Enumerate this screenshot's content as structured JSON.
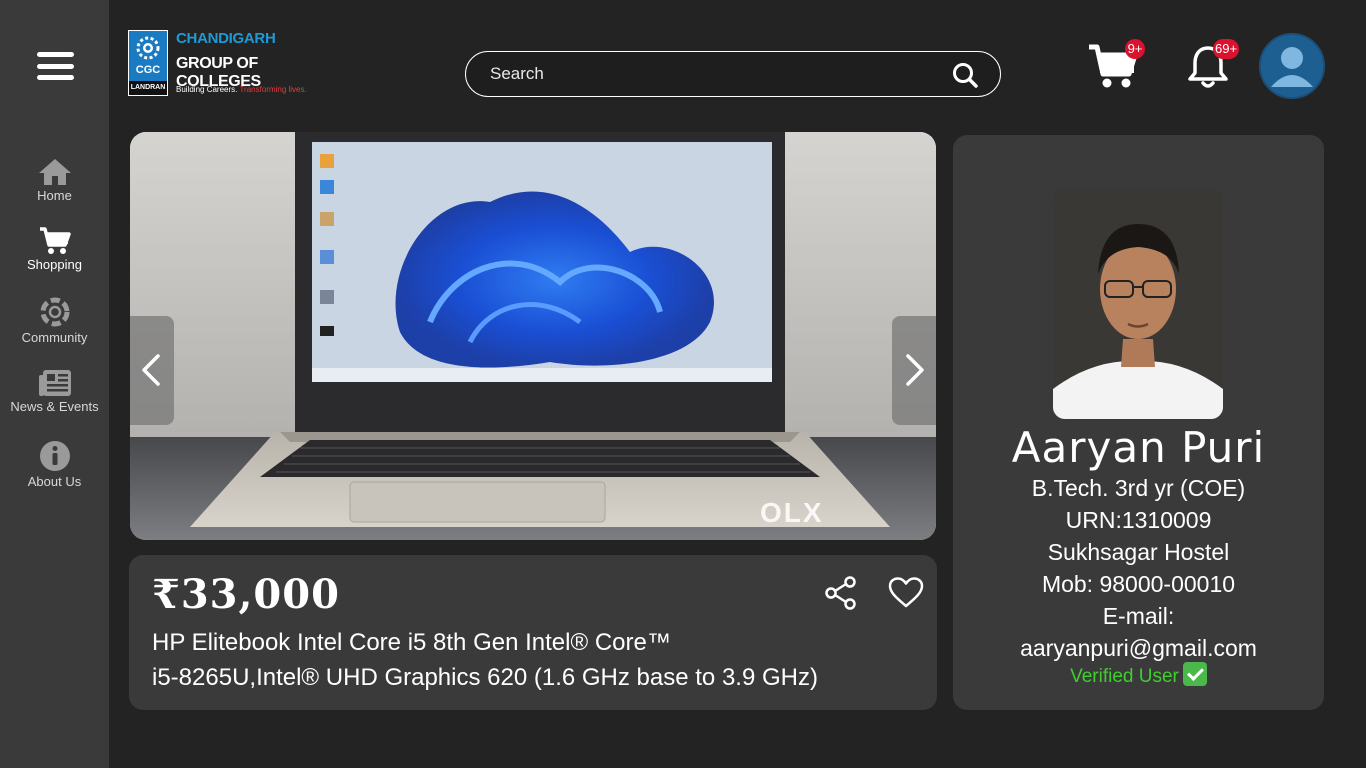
{
  "sidebar": {
    "items": [
      {
        "label": "Home",
        "icon": "home-icon"
      },
      {
        "label": "Shopping",
        "icon": "cart-icon"
      },
      {
        "label": "Community",
        "icon": "community-icon"
      },
      {
        "label": "News & Events",
        "icon": "news-icon"
      },
      {
        "label": "About Us",
        "icon": "info-icon"
      }
    ],
    "active": "Shopping"
  },
  "header": {
    "logo": {
      "badge_text": "CGC",
      "badge_sub": "LANDRAN",
      "line1": "CHANDIGARH",
      "line2": "GROUP OF COLLEGES",
      "tagline_a": "Building Careers.",
      "tagline_b": "Transforming lives."
    },
    "search": {
      "placeholder": "Search"
    },
    "cart_badge": "9+",
    "notifications_badge": "69+"
  },
  "product": {
    "price": "₹33,000",
    "title_line1": "HP Elitebook Intel Core i5 8th Gen Intel® Core™",
    "title_line2": "i5-8265U,Intel® UHD Graphics 620 (1.6 GHz base to 3.9 GHz)",
    "image_watermark": "OLX"
  },
  "seller": {
    "name": "Aaryan Puri",
    "course": "B.Tech. 3rd yr (COE)",
    "urn": "URN:1310009",
    "hostel": "Sukhsagar Hostel",
    "mobile": "Mob: 98000-00010",
    "email_label": "E-mail:",
    "email": "aaryanpuri@gmail.com",
    "verified": "Verified User"
  },
  "colors": {
    "background": "#232323",
    "sidebar": "#3a3a3a",
    "card": "#3a3a3a",
    "badge": "#d9122d",
    "verified": "#3fcf2d",
    "logo_blue": "#1f9ad6"
  }
}
